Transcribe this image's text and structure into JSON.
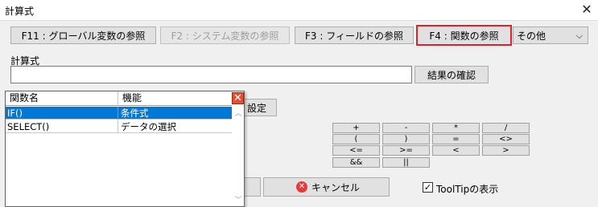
{
  "window": {
    "title": "計算式",
    "close_icon": "close-icon"
  },
  "tabs": [
    {
      "label": "F11 : グローバル変数の参照"
    },
    {
      "label": "F2 : システム変数の参照"
    },
    {
      "label": "F3 : フィールドの参照"
    },
    {
      "label": "F4 : 関数の参照"
    }
  ],
  "other_dropdown": {
    "value": "その他",
    "icon": "chevron-down-icon"
  },
  "formula": {
    "label": "計算式",
    "value": "",
    "check_button": "結果の確認"
  },
  "partial_button": "設定",
  "functions": {
    "columns": [
      "関数名",
      "機能"
    ],
    "rows": [
      {
        "name": "IF()",
        "desc": "条件式",
        "selected": true
      },
      {
        "name": "SELECT()",
        "desc": "データの選択",
        "selected": false
      }
    ],
    "close_icon": "close-icon"
  },
  "operators": [
    "+",
    "-",
    "*",
    "/",
    "(",
    ")",
    "=",
    "<>",
    "<=",
    ">=",
    "<",
    ">",
    "&&",
    "||"
  ],
  "cancel": {
    "label": "キャンセル",
    "icon": "cancel-icon"
  },
  "tooltip": {
    "label": "ToolTipの表示",
    "checked": true
  },
  "colors": {
    "selection": "#0078d7",
    "focus_border": "#e0202a",
    "close_red": "#e7502e"
  }
}
